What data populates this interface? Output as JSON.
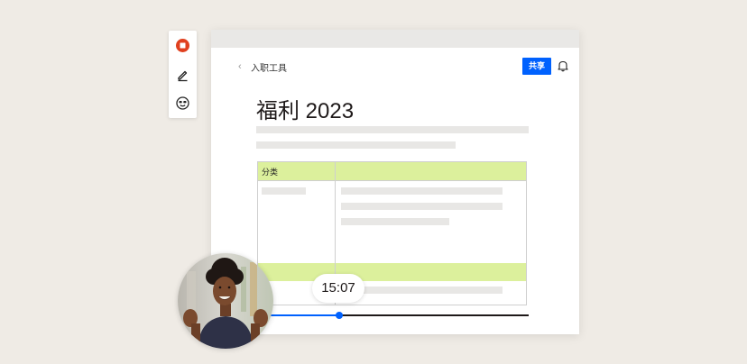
{
  "toolbar": {
    "icons": [
      "stop-record-icon",
      "pencil-icon",
      "face-icon"
    ],
    "accent": "#e0401f"
  },
  "document": {
    "breadcrumb": "入职工具",
    "share_label": "共享",
    "title": "福利 2023",
    "table_header": "分类",
    "highlight_color": "#dcf09c",
    "brand_color": "#0061fe"
  },
  "video": {
    "timestamp": "15:07",
    "progress_fraction": 0.27
  }
}
